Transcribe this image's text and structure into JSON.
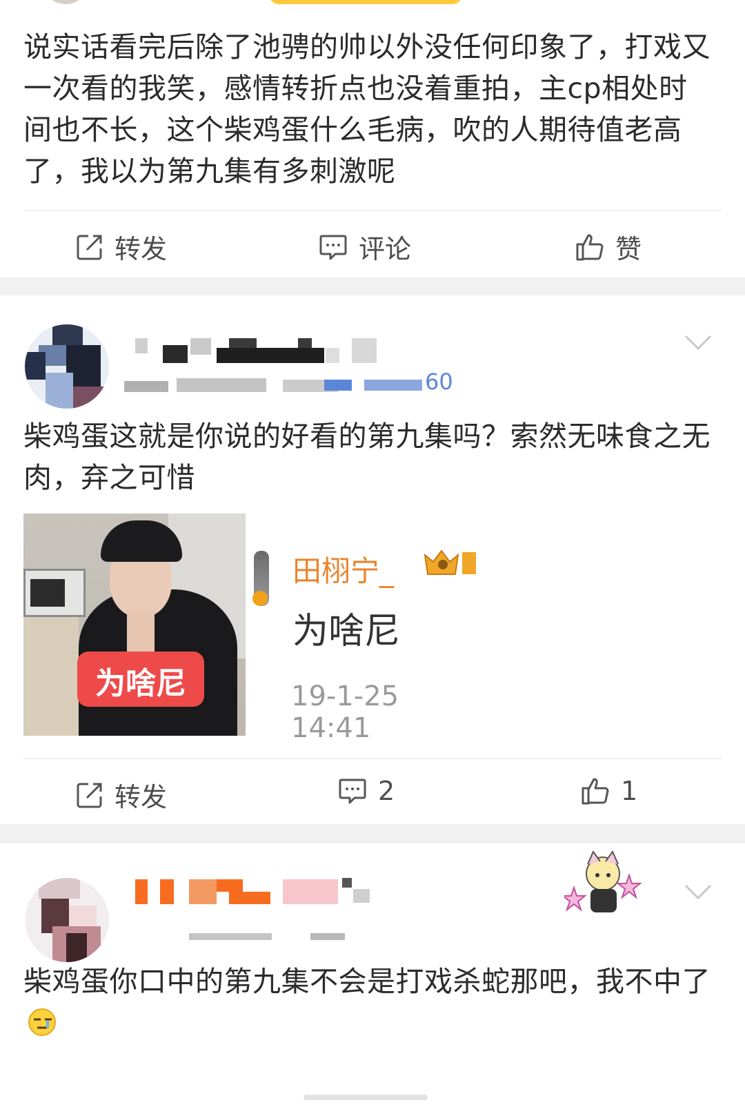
{
  "post1": {
    "text": "说实话看完后除了池骋的帅以外没任何印象了，打戏又一次看的我笑，感情转折点也没着重拍，主cp相处时间也不长，这个柴鸡蛋什么毛病，吹的人期待值老高了，我以为第九集有多刺激呢",
    "actions": {
      "repost": "转发",
      "comment": "评论",
      "like": "赞"
    }
  },
  "post2": {
    "meta_tail": "60",
    "text": "柴鸡蛋这就是你说的好看的第九集吗？索然无味食之无肉，弃之可惜",
    "image": {
      "caption": "为啥尼",
      "quoted_user": "田栩宁_",
      "quoted_text": "为啥尼",
      "quoted_time": "19-1-25 14:41"
    },
    "actions": {
      "repost": "转发",
      "comment_count": "2",
      "like_count": "1"
    }
  },
  "post3": {
    "text": "柴鸡蛋你口中的第九集不会是打戏杀蛇那吧，我不中了"
  },
  "colors": {
    "accent_orange": "#f76c1f",
    "text": "#2b2b2b",
    "muted": "#8a8a8a",
    "separator": "#f1f1f1"
  }
}
